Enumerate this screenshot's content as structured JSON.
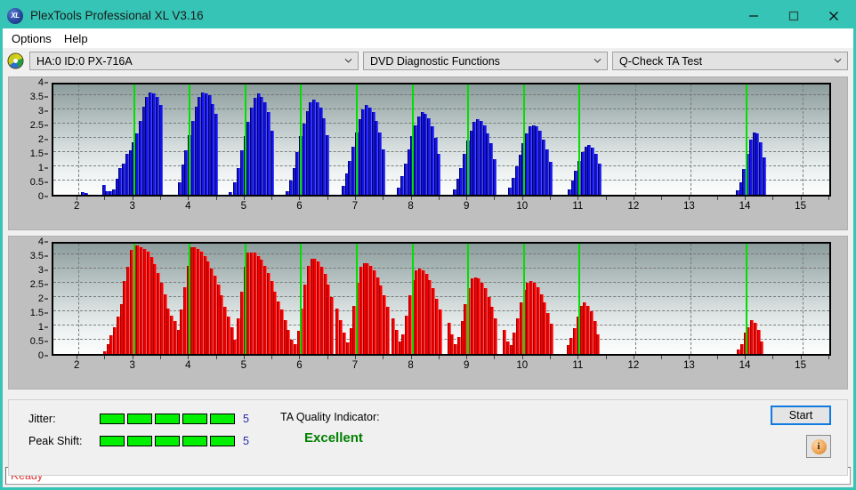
{
  "window": {
    "title": "PlexTools Professional XL V3.16",
    "app_icon": "xl-logo-icon",
    "minimize_label": "minimize-icon",
    "maximize_label": "maximize-icon",
    "close_label": "close-icon"
  },
  "menu": {
    "items": [
      {
        "label": "Options"
      },
      {
        "label": "Help"
      }
    ]
  },
  "toolbar": {
    "disc_icon": "disc-icon",
    "drive_select": {
      "value": "HA:0 ID:0  PX-716A"
    },
    "function_select": {
      "value": "DVD Diagnostic Functions"
    },
    "test_select": {
      "value": "Q-Check TA Test"
    }
  },
  "results": {
    "jitter_label": "Jitter:",
    "jitter_value": "5",
    "jitter_segments": 5,
    "jitter_segments_total": 5,
    "peak_shift_label": "Peak Shift:",
    "peak_shift_value": "5",
    "peak_shift_segments": 5,
    "peak_shift_segments_total": 5,
    "ta_quality_label": "TA Quality Indicator:",
    "ta_quality_value": "Excellent",
    "ta_quality_color": "#008000",
    "start_button": "Start",
    "info_button": "i"
  },
  "statusbar": {
    "text": "Ready",
    "color": "#e03030"
  },
  "chart_data": [
    {
      "id": "jitter-chart",
      "type": "bar",
      "title": "",
      "xlabel": "",
      "ylabel": "",
      "series_color": "#1414e6",
      "ylim": [
        0,
        4
      ],
      "yticks": [
        0,
        0.5,
        1,
        1.5,
        2,
        2.5,
        3,
        3.5,
        4
      ],
      "xlim": [
        1.55,
        15.55
      ],
      "xticks": [
        2,
        3,
        4,
        5,
        6,
        7,
        8,
        9,
        10,
        11,
        12,
        13,
        14,
        15
      ],
      "grid": true,
      "markers": [
        3,
        4,
        5,
        6,
        7,
        8,
        9,
        10,
        11,
        14
      ],
      "marker_color": "#00e000",
      "bar_width": 0.03,
      "x": [
        2.06,
        2.12,
        2.44,
        2.5,
        2.56,
        2.62,
        2.68,
        2.74,
        2.8,
        2.86,
        2.92,
        2.98,
        3.04,
        3.1,
        3.16,
        3.22,
        3.28,
        3.34,
        3.4,
        3.46,
        3.8,
        3.86,
        3.92,
        3.98,
        4.04,
        4.1,
        4.16,
        4.22,
        4.28,
        4.34,
        4.4,
        4.46,
        4.72,
        4.8,
        4.86,
        4.92,
        4.98,
        5.04,
        5.1,
        5.16,
        5.22,
        5.28,
        5.34,
        5.4,
        5.46,
        5.74,
        5.8,
        5.86,
        5.92,
        5.98,
        6.04,
        6.1,
        6.16,
        6.22,
        6.28,
        6.34,
        6.4,
        6.46,
        6.74,
        6.8,
        6.86,
        6.92,
        6.98,
        7.04,
        7.1,
        7.16,
        7.22,
        7.28,
        7.34,
        7.4,
        7.46,
        7.74,
        7.8,
        7.86,
        7.92,
        7.98,
        8.04,
        8.1,
        8.16,
        8.22,
        8.28,
        8.34,
        8.4,
        8.46,
        8.74,
        8.8,
        8.86,
        8.92,
        8.98,
        9.04,
        9.1,
        9.16,
        9.22,
        9.28,
        9.34,
        9.4,
        9.46,
        9.74,
        9.8,
        9.86,
        9.92,
        9.98,
        10.04,
        10.1,
        10.16,
        10.22,
        10.28,
        10.34,
        10.4,
        10.46,
        10.8,
        10.86,
        10.92,
        10.98,
        11.04,
        11.1,
        11.16,
        11.22,
        11.28,
        11.34,
        13.82,
        13.88,
        13.94,
        14.0,
        14.06,
        14.12,
        14.18,
        14.24,
        14.3
      ],
      "values": [
        0.1,
        0.07,
        0.35,
        0.12,
        0.14,
        0.2,
        0.55,
        0.95,
        1.1,
        1.45,
        1.55,
        1.85,
        2.15,
        2.6,
        3.1,
        3.45,
        3.6,
        3.55,
        3.45,
        3.15,
        0.45,
        1.05,
        1.55,
        2.1,
        2.6,
        3.1,
        3.45,
        3.6,
        3.55,
        3.5,
        3.2,
        2.85,
        0.1,
        0.45,
        0.95,
        1.55,
        2.05,
        2.55,
        3.05,
        3.4,
        3.55,
        3.45,
        3.25,
        2.9,
        2.25,
        0.12,
        0.5,
        0.95,
        1.5,
        2.05,
        2.5,
        2.95,
        3.25,
        3.35,
        3.25,
        3.05,
        2.7,
        2.1,
        0.3,
        0.75,
        1.2,
        1.7,
        2.2,
        2.65,
        3.0,
        3.15,
        3.05,
        2.9,
        2.6,
        2.2,
        1.6,
        0.25,
        0.65,
        1.1,
        1.6,
        2.05,
        2.45,
        2.75,
        2.9,
        2.85,
        2.7,
        2.4,
        2.0,
        1.45,
        0.2,
        0.55,
        0.95,
        1.45,
        1.9,
        2.25,
        2.55,
        2.65,
        2.6,
        2.45,
        2.15,
        1.8,
        1.25,
        0.25,
        0.6,
        1.0,
        1.4,
        1.8,
        2.15,
        2.4,
        2.45,
        2.4,
        2.25,
        1.95,
        1.6,
        1.15,
        0.2,
        0.5,
        0.85,
        1.2,
        1.5,
        1.7,
        1.75,
        1.65,
        1.45,
        1.1,
        0.15,
        0.45,
        0.9,
        1.45,
        1.95,
        2.2,
        2.15,
        1.85,
        1.3
      ]
    },
    {
      "id": "peak-shift-chart",
      "type": "bar",
      "title": "",
      "xlabel": "",
      "ylabel": "",
      "series_color": "#f40000",
      "ylim": [
        0,
        4
      ],
      "yticks": [
        0,
        0.5,
        1,
        1.5,
        2,
        2.5,
        3,
        3.5,
        4
      ],
      "xlim": [
        1.55,
        15.55
      ],
      "xticks": [
        2,
        3,
        4,
        5,
        6,
        7,
        8,
        9,
        10,
        11,
        12,
        13,
        14,
        15
      ],
      "grid": true,
      "markers": [
        3,
        4,
        5,
        6,
        7,
        8,
        9,
        10,
        11,
        14
      ],
      "marker_color": "#00e000",
      "bar_width": 0.03,
      "x": [
        2.46,
        2.52,
        2.58,
        2.64,
        2.7,
        2.76,
        2.82,
        2.88,
        2.94,
        3.0,
        3.06,
        3.12,
        3.18,
        3.24,
        3.3,
        3.36,
        3.42,
        3.48,
        3.54,
        3.6,
        3.66,
        3.72,
        3.78,
        3.84,
        3.9,
        3.96,
        4.02,
        4.08,
        4.14,
        4.2,
        4.26,
        4.32,
        4.38,
        4.44,
        4.5,
        4.56,
        4.62,
        4.68,
        4.74,
        4.8,
        4.86,
        4.92,
        4.98,
        5.04,
        5.1,
        5.16,
        5.22,
        5.28,
        5.34,
        5.4,
        5.46,
        5.52,
        5.58,
        5.64,
        5.7,
        5.76,
        5.82,
        5.88,
        5.94,
        6.0,
        6.06,
        6.12,
        6.18,
        6.24,
        6.3,
        6.36,
        6.42,
        6.48,
        6.54,
        6.64,
        6.7,
        6.76,
        6.82,
        6.88,
        6.94,
        7.0,
        7.06,
        7.12,
        7.18,
        7.24,
        7.3,
        7.36,
        7.42,
        7.48,
        7.54,
        7.64,
        7.7,
        7.76,
        7.82,
        7.88,
        7.94,
        8.0,
        8.06,
        8.12,
        8.18,
        8.24,
        8.3,
        8.36,
        8.42,
        8.48,
        8.64,
        8.7,
        8.76,
        8.82,
        8.88,
        8.94,
        9.0,
        9.06,
        9.12,
        9.18,
        9.24,
        9.3,
        9.36,
        9.42,
        9.48,
        9.64,
        9.7,
        9.76,
        9.82,
        9.88,
        9.94,
        10.0,
        10.06,
        10.12,
        10.18,
        10.24,
        10.3,
        10.36,
        10.42,
        10.48,
        10.78,
        10.84,
        10.9,
        10.96,
        11.02,
        11.08,
        11.14,
        11.2,
        11.26,
        11.32,
        13.84,
        13.9,
        13.96,
        14.02,
        14.08,
        14.14,
        14.2,
        14.26
      ],
      "values": [
        0.1,
        0.35,
        0.65,
        0.95,
        1.3,
        1.75,
        2.55,
        3.05,
        3.65,
        3.8,
        3.8,
        3.75,
        3.7,
        3.6,
        3.4,
        3.15,
        2.85,
        2.5,
        2.1,
        1.6,
        1.35,
        1.15,
        0.85,
        1.55,
        2.35,
        3.1,
        3.75,
        3.75,
        3.7,
        3.6,
        3.45,
        3.25,
        3.0,
        2.75,
        2.45,
        2.05,
        1.65,
        1.3,
        0.95,
        0.5,
        1.25,
        2.2,
        3.05,
        3.55,
        3.55,
        3.55,
        3.45,
        3.3,
        3.1,
        2.85,
        2.55,
        2.2,
        1.85,
        1.55,
        1.2,
        0.85,
        0.5,
        0.35,
        0.8,
        1.6,
        2.45,
        3.1,
        3.35,
        3.35,
        3.25,
        3.05,
        2.8,
        2.45,
        2.0,
        1.6,
        1.2,
        0.75,
        0.4,
        0.9,
        1.7,
        2.5,
        3.05,
        3.2,
        3.2,
        3.1,
        2.95,
        2.7,
        2.4,
        2.05,
        1.65,
        1.25,
        0.85,
        0.45,
        0.7,
        1.35,
        2.05,
        2.6,
        2.95,
        3.0,
        2.95,
        2.8,
        2.6,
        2.3,
        1.95,
        1.55,
        1.1,
        0.7,
        0.35,
        0.6,
        1.15,
        1.75,
        2.3,
        2.65,
        2.7,
        2.65,
        2.5,
        2.3,
        2.0,
        1.65,
        1.25,
        0.85,
        0.45,
        0.3,
        0.75,
        1.25,
        1.8,
        2.25,
        2.5,
        2.55,
        2.5,
        2.35,
        2.1,
        1.8,
        1.45,
        1.05,
        0.3,
        0.55,
        0.9,
        1.3,
        1.7,
        1.8,
        1.7,
        1.5,
        1.15,
        0.7,
        0.15,
        0.35,
        0.75,
        0.95,
        1.2,
        1.1,
        0.85,
        0.45
      ]
    }
  ]
}
